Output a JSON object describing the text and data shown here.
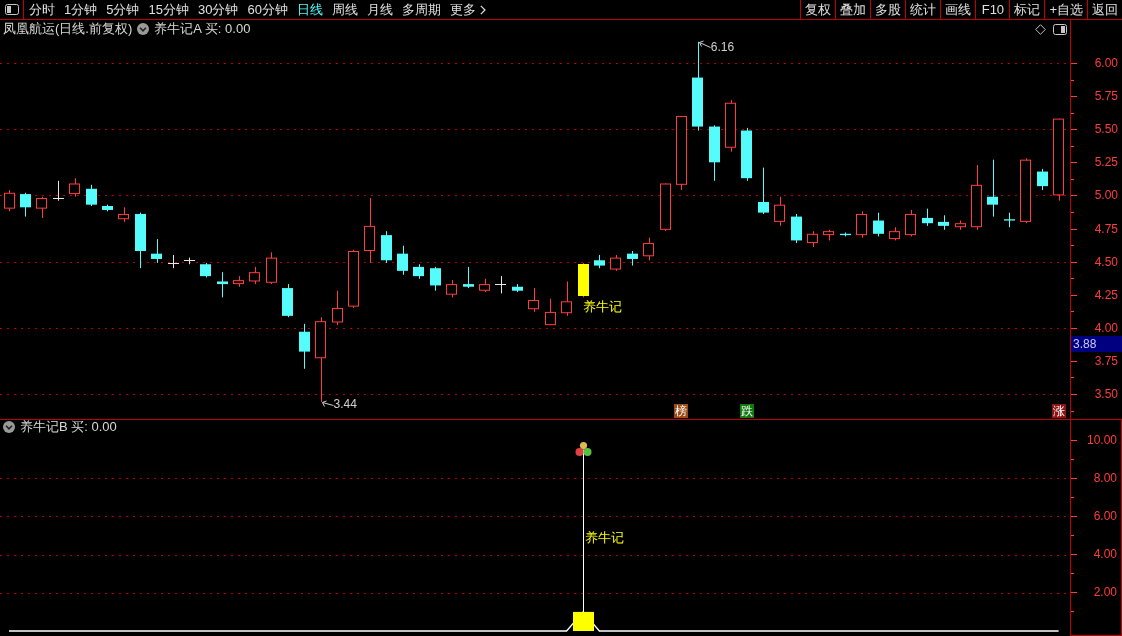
{
  "toolbar": {
    "tabs": [
      {
        "label": "分时",
        "selected": false,
        "menu": false
      },
      {
        "label": "1分钟",
        "selected": false,
        "menu": false
      },
      {
        "label": "5分钟",
        "selected": false,
        "menu": false
      },
      {
        "label": "15分钟",
        "selected": false,
        "menu": false
      },
      {
        "label": "30分钟",
        "selected": false,
        "menu": false
      },
      {
        "label": "60分钟",
        "selected": false,
        "menu": false
      },
      {
        "label": "日线",
        "selected": true,
        "menu": false
      },
      {
        "label": "周线",
        "selected": false,
        "menu": false
      },
      {
        "label": "月线",
        "selected": false,
        "menu": false
      },
      {
        "label": "多周期",
        "selected": false,
        "menu": false
      },
      {
        "label": "更多",
        "selected": false,
        "menu": true
      }
    ],
    "buttons": [
      "复权",
      "叠加",
      "多股",
      "统计",
      "画线",
      "F10",
      "标记",
      "+自选",
      "返回"
    ]
  },
  "main_panel": {
    "title": "凤凰航运(日线.前复权)",
    "indicator": "养牛记A 买: 0.00",
    "high_label": "6.16",
    "low_label": "3.44",
    "price_marker": "3.88",
    "signal": {
      "label": "养牛记",
      "color": "#ffff00"
    },
    "badges": [
      {
        "label": "榜",
        "color": "#9a4a14"
      },
      {
        "label": "跌",
        "color": "#0e7a0e"
      },
      {
        "label": "涨",
        "color": "#8a1414"
      }
    ],
    "chart_data": {
      "type": "candlestick",
      "ohlc": [
        [
          4.9,
          5.04,
          4.88,
          5.02
        ],
        [
          5.01,
          5.02,
          4.84,
          4.91
        ],
        [
          4.9,
          4.99,
          4.83,
          4.98
        ],
        [
          4.98,
          5.11,
          4.96,
          4.98
        ],
        [
          5.01,
          5.13,
          4.99,
          5.09
        ],
        [
          5.05,
          5.08,
          4.92,
          4.93
        ],
        [
          4.92,
          4.93,
          4.88,
          4.89
        ],
        [
          4.82,
          4.91,
          4.8,
          4.86
        ],
        [
          4.86,
          4.87,
          4.45,
          4.58
        ],
        [
          4.56,
          4.67,
          4.49,
          4.52
        ],
        [
          4.49,
          4.55,
          4.45,
          4.49
        ],
        [
          4.51,
          4.53,
          4.48,
          4.51
        ],
        [
          4.48,
          4.49,
          4.38,
          4.39
        ],
        [
          4.35,
          4.42,
          4.23,
          4.33
        ],
        [
          4.33,
          4.39,
          4.31,
          4.36
        ],
        [
          4.35,
          4.46,
          4.33,
          4.42
        ],
        [
          4.34,
          4.57,
          4.33,
          4.53
        ],
        [
          4.3,
          4.33,
          4.08,
          4.09
        ],
        [
          3.97,
          4.03,
          3.69,
          3.82
        ],
        [
          3.77,
          4.08,
          3.44,
          4.05
        ],
        [
          4.04,
          4.28,
          4.02,
          4.15
        ],
        [
          4.16,
          4.59,
          4.15,
          4.58
        ],
        [
          4.58,
          4.98,
          4.49,
          4.77
        ],
        [
          4.7,
          4.73,
          4.49,
          4.51
        ],
        [
          4.56,
          4.62,
          4.4,
          4.43
        ],
        [
          4.46,
          4.48,
          4.37,
          4.39
        ],
        [
          4.45,
          4.46,
          4.28,
          4.32
        ],
        [
          4.25,
          4.36,
          4.23,
          4.33
        ],
        [
          4.33,
          4.46,
          4.3,
          4.31
        ],
        [
          4.28,
          4.37,
          4.27,
          4.33
        ],
        [
          4.33,
          4.39,
          4.26,
          4.33
        ],
        [
          4.31,
          4.33,
          4.27,
          4.28
        ],
        [
          4.14,
          4.3,
          4.12,
          4.21
        ],
        [
          4.02,
          4.22,
          4.02,
          4.12
        ],
        [
          4.11,
          4.35,
          4.09,
          4.2
        ],
        [
          4.25,
          4.49,
          4.23,
          4.48
        ],
        [
          4.51,
          4.55,
          4.45,
          4.47
        ],
        [
          4.44,
          4.55,
          4.43,
          4.53
        ],
        [
          4.56,
          4.58,
          4.47,
          4.52
        ],
        [
          4.54,
          4.68,
          4.51,
          4.64
        ],
        [
          4.74,
          5.09,
          4.73,
          5.09
        ],
        [
          5.08,
          5.6,
          5.04,
          5.6
        ],
        [
          5.89,
          6.16,
          5.49,
          5.52
        ],
        [
          5.52,
          5.53,
          5.11,
          5.25
        ],
        [
          5.36,
          5.72,
          5.33,
          5.7
        ],
        [
          5.49,
          5.51,
          5.11,
          5.13
        ],
        [
          4.95,
          5.21,
          4.86,
          4.87
        ],
        [
          4.8,
          4.99,
          4.77,
          4.93
        ],
        [
          4.84,
          4.86,
          4.64,
          4.66
        ],
        [
          4.64,
          4.73,
          4.61,
          4.71
        ],
        [
          4.7,
          4.74,
          4.66,
          4.73
        ],
        [
          4.71,
          4.72,
          4.69,
          4.7
        ],
        [
          4.7,
          4.88,
          4.68,
          4.86
        ],
        [
          4.81,
          4.87,
          4.69,
          4.71
        ],
        [
          4.67,
          4.76,
          4.66,
          4.73
        ],
        [
          4.7,
          4.89,
          4.69,
          4.86
        ],
        [
          4.83,
          4.9,
          4.77,
          4.79
        ],
        [
          4.8,
          4.85,
          4.74,
          4.77
        ],
        [
          4.76,
          4.81,
          4.74,
          4.79
        ],
        [
          4.76,
          5.23,
          4.74,
          5.08
        ],
        [
          4.99,
          5.27,
          4.84,
          4.93
        ],
        [
          4.82,
          4.87,
          4.76,
          4.81
        ],
        [
          4.8,
          5.28,
          4.79,
          5.27
        ],
        [
          5.18,
          5.2,
          5.04,
          5.07
        ],
        [
          5.0,
          5.58,
          4.96,
          5.58
        ]
      ],
      "ylim": [
        3.311,
        6.189
      ],
      "yticks": [
        {
          "value": 6,
          "label": "6.00"
        },
        {
          "value": 5.75,
          "label": "5.75"
        },
        {
          "value": 5.5,
          "label": "5.50"
        },
        {
          "value": 5.25,
          "label": "5.25"
        },
        {
          "value": 5,
          "label": "5.00"
        },
        {
          "value": 4.75,
          "label": "4.75"
        },
        {
          "value": 4.5,
          "label": "4.50"
        },
        {
          "value": 4.25,
          "label": "4.25"
        },
        {
          "value": 4,
          "label": "4.00"
        },
        {
          "value": 3.75,
          "label": "3.75"
        },
        {
          "value": 3.5,
          "label": "3.50"
        }
      ],
      "grid": true
    }
  },
  "indicator_panel": {
    "indicator": "养牛记B 买: 0.00",
    "chart_data": {
      "type": "bar",
      "ylim": [
        -0.26,
        10.31
      ],
      "yticks": [
        {
          "value": 10,
          "label": "10.00"
        },
        {
          "value": 8,
          "label": "8.00"
        },
        {
          "value": 6,
          "label": "6.00"
        },
        {
          "value": 4,
          "label": "4.00"
        },
        {
          "value": 2,
          "label": "2.00"
        }
      ],
      "grid": true,
      "series": [
        {
          "color": "#ffff00",
          "values": [
            null,
            null,
            null,
            null,
            null,
            null,
            null,
            null,
            null,
            null,
            null,
            null,
            null,
            null,
            null,
            null,
            null,
            null,
            null,
            null,
            null,
            null,
            null,
            null,
            null,
            null,
            null,
            null,
            null,
            null,
            null,
            null,
            null,
            null,
            null,
            1,
            null,
            null,
            null,
            null,
            null,
            null,
            null,
            null,
            null,
            null,
            null,
            null,
            null,
            null,
            null,
            null,
            null,
            null,
            null,
            null,
            null,
            null,
            null,
            null,
            null,
            null,
            null,
            null,
            null
          ]
        },
        {
          "type": "line",
          "color": "#ffffff",
          "values": [
            0,
            0,
            0,
            0,
            0,
            0,
            0,
            0,
            0,
            0,
            0,
            0,
            0,
            0,
            0,
            0,
            0,
            0,
            0,
            0,
            0,
            0,
            0,
            0,
            0,
            0,
            0,
            0,
            0,
            0,
            0,
            0,
            0,
            0,
            0,
            1,
            0,
            0,
            0,
            0,
            0,
            0,
            0,
            0,
            0,
            0,
            0,
            0,
            0,
            0,
            0,
            0,
            0,
            0,
            0,
            0,
            0,
            0,
            0,
            0,
            0,
            0,
            0,
            0,
            0
          ]
        }
      ],
      "annotations": [
        "养牛记"
      ]
    }
  }
}
